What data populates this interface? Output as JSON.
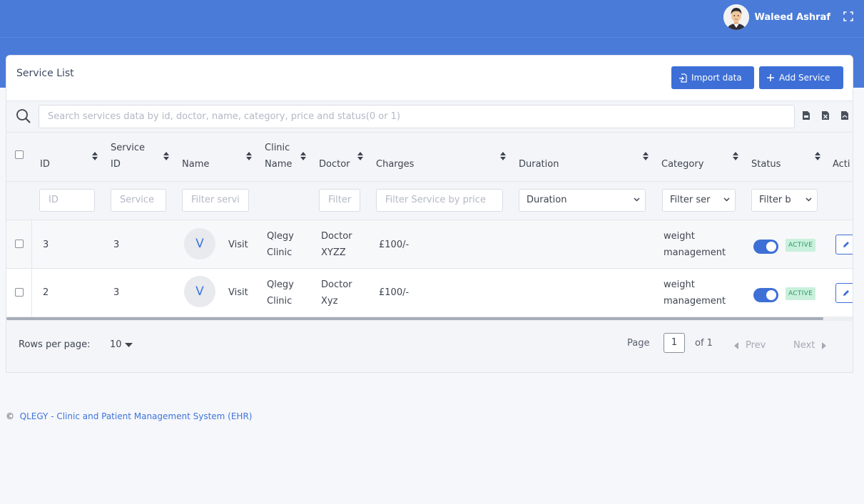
{
  "header": {
    "user_name": "Waleed Ashraf"
  },
  "card": {
    "title": "Service List",
    "import_label": "Import data",
    "add_label": "Add Service"
  },
  "search": {
    "placeholder": "Search services data by id, doctor, name, category, price  and status(0 or 1)"
  },
  "columns": {
    "id": "ID",
    "service_id_1": "Service",
    "service_id_2": "ID",
    "name": "Name",
    "clinic_1": "Clinic",
    "clinic_2": "Name",
    "doctor": "Doctor",
    "charges": "Charges",
    "duration": "Duration",
    "category": "Category",
    "status": "Status",
    "action": "Acti"
  },
  "filters": {
    "id": "ID",
    "service": "Service",
    "name": "Filter servi",
    "doctor": "Filter",
    "charges": "Filter Service by price",
    "duration": "Duration",
    "category": "Filter ser",
    "status": "Filter b"
  },
  "rows": [
    {
      "id": "3",
      "service_id": "3",
      "initial": "V",
      "name": "Visit",
      "clinic_1": "Qlegy",
      "clinic_2": "Clinic",
      "doctor_1": "Doctor",
      "doctor_2": "XYZZ",
      "charges": "£100/-",
      "category_1": "weight",
      "category_2": "management",
      "status": "ACTIVE"
    },
    {
      "id": "2",
      "service_id": "3",
      "initial": "V",
      "name": "Visit",
      "clinic_1": "Qlegy",
      "clinic_2": "Clinic",
      "doctor_1": "Doctor",
      "doctor_2": "Xyz",
      "charges": "£100/-",
      "category_1": "weight",
      "category_2": "management",
      "status": "ACTIVE"
    }
  ],
  "pagination": {
    "rows_per_page_label": "Rows per page:",
    "rows_per_page": "10",
    "page_label": "Page",
    "page": "1",
    "of_label": "of 1",
    "prev": "Prev",
    "next": "Next"
  },
  "footer": {
    "symbol": "©",
    "text": "QLEGY - Clinic and Patient Management System (EHR)"
  },
  "colors": {
    "primary": "#4a7bd9",
    "button": "#3d6fd6",
    "active_badge_bg": "#c9f0dc",
    "active_badge_text": "#2a9a63"
  },
  "icons": [
    "avatar",
    "fullscreen-icon",
    "import-icon",
    "plus-icon",
    "search-icon",
    "csv-icon",
    "excel-icon",
    "pdf-icon",
    "sort-icon",
    "chevron-down-icon",
    "edit-icon",
    "caret-left-icon",
    "caret-right-icon"
  ]
}
